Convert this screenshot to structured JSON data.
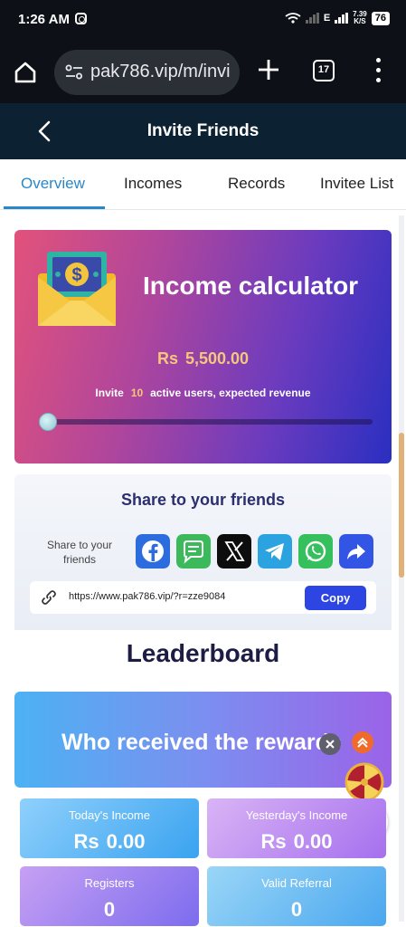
{
  "status_bar": {
    "time": "1:26 AM",
    "network_type": "E",
    "speed_value": "7.39",
    "speed_unit": "K/S",
    "battery": "76"
  },
  "browser": {
    "url": "pak786.vip/m/invi",
    "tab_count": "17"
  },
  "header": {
    "title": "Invite Friends"
  },
  "tabs": [
    {
      "label": "Overview",
      "active": true
    },
    {
      "label": "Incomes",
      "active": false
    },
    {
      "label": "Records",
      "active": false
    },
    {
      "label": "Invitee List",
      "active": false
    }
  ],
  "income_calculator": {
    "title": "Income calculator",
    "currency": "Rs",
    "amount": "5,500.00",
    "invite_prefix": "Invite",
    "invite_count": "10",
    "invite_suffix": "active users, expected revenue",
    "slider_level": 0.02
  },
  "share": {
    "title": "Share to your friends",
    "label": "Share to your friends",
    "icons": [
      "facebook-icon",
      "sms-icon",
      "x-icon",
      "telegram-icon",
      "whatsapp-icon",
      "forward-icon"
    ],
    "link": "https://www.pak786.vip/?r=zze9084",
    "copy_label": "Copy"
  },
  "leaderboard": {
    "title": "Leaderboard",
    "banner_text": "Who received the rewards"
  },
  "stats": [
    {
      "label": "Today's Income",
      "currency": "Rs",
      "value": "0.00"
    },
    {
      "label": "Yesterday's Income",
      "currency": "Rs",
      "value": "0.00"
    },
    {
      "label": "Registers",
      "value": "0"
    },
    {
      "label": "Valid Referral",
      "value": "0"
    }
  ],
  "colors": {
    "status_bg": "#0d1117",
    "header_bg": "#0c2233",
    "tab_active": "#2a87c8",
    "amount_gold": "#f6c77b",
    "copy_button": "#2d46e3",
    "leaderboard_title": "#1c1c45"
  }
}
